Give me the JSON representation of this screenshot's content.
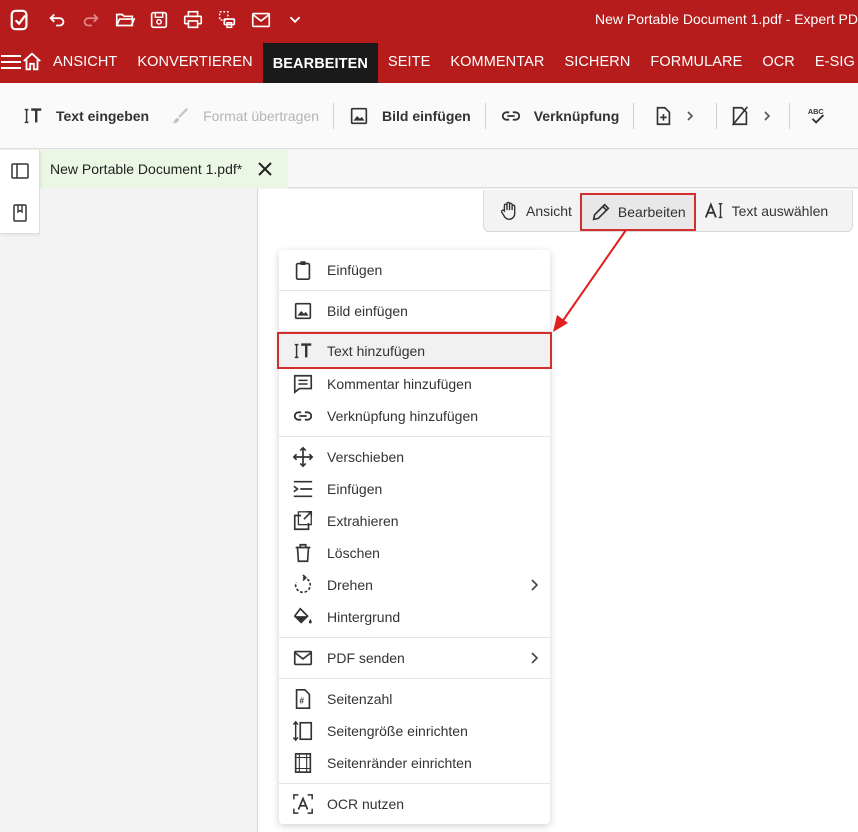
{
  "window": {
    "title": "New Portable Document 1.pdf   -   Expert PD"
  },
  "titlebar_icons": [
    "app-logo-icon",
    "undo-icon",
    "redo-icon",
    "open-folder-icon",
    "save-icon",
    "print-icon",
    "scan-icon",
    "email-icon",
    "chevron-down-icon"
  ],
  "menu": {
    "items": [
      "ANSICHT",
      "KONVERTIEREN",
      "BEARBEITEN",
      "SEITE",
      "KOMMENTAR",
      "SICHERN",
      "FORMULARE",
      "OCR",
      "E-SIG"
    ],
    "active": "BEARBEITEN"
  },
  "toolbar": {
    "text_input": "Text eingeben",
    "format_transfer": "Format übertragen",
    "insert_image": "Bild einfügen",
    "link": "Verknüpfung"
  },
  "tab": {
    "label": "New Portable Document 1.pdf*"
  },
  "modes": {
    "view": "Ansicht",
    "edit": "Bearbeiten",
    "select_text": "Text auswählen",
    "active": "Bearbeiten"
  },
  "context_menu": {
    "items": [
      {
        "label": "Einfügen",
        "icon": "clipboard-icon"
      },
      {
        "label": "Bild einfügen",
        "icon": "image-icon"
      },
      {
        "label": "Text hinzufügen",
        "icon": "text-cursor-icon",
        "highlighted": true
      },
      {
        "label": "Kommentar hinzufügen",
        "icon": "comment-icon"
      },
      {
        "label": "Verknüpfung hinzufügen",
        "icon": "link-icon"
      },
      {
        "label": "Verschieben",
        "icon": "move-icon"
      },
      {
        "label": "Einfügen",
        "icon": "insert-space-icon"
      },
      {
        "label": "Extrahieren",
        "icon": "extract-icon"
      },
      {
        "label": "Löschen",
        "icon": "trash-icon"
      },
      {
        "label": "Drehen",
        "icon": "rotate-icon",
        "submenu": true
      },
      {
        "label": "Hintergrund",
        "icon": "paint-bucket-icon"
      },
      {
        "label": "PDF senden",
        "icon": "email-icon",
        "submenu": true
      },
      {
        "label": "Seitenzahl",
        "icon": "page-number-icon"
      },
      {
        "label": "Seitengröße einrichten",
        "icon": "page-size-icon"
      },
      {
        "label": "Seitenränder einrichten",
        "icon": "page-margins-icon"
      },
      {
        "label": "OCR nutzen",
        "icon": "ocr-icon"
      }
    ]
  },
  "colors": {
    "brand": "#b71c1c",
    "highlight": "#d32f2f",
    "active_tab_bg": "#1a1a1a",
    "doc_tab_bg": "#eaf7e4"
  }
}
